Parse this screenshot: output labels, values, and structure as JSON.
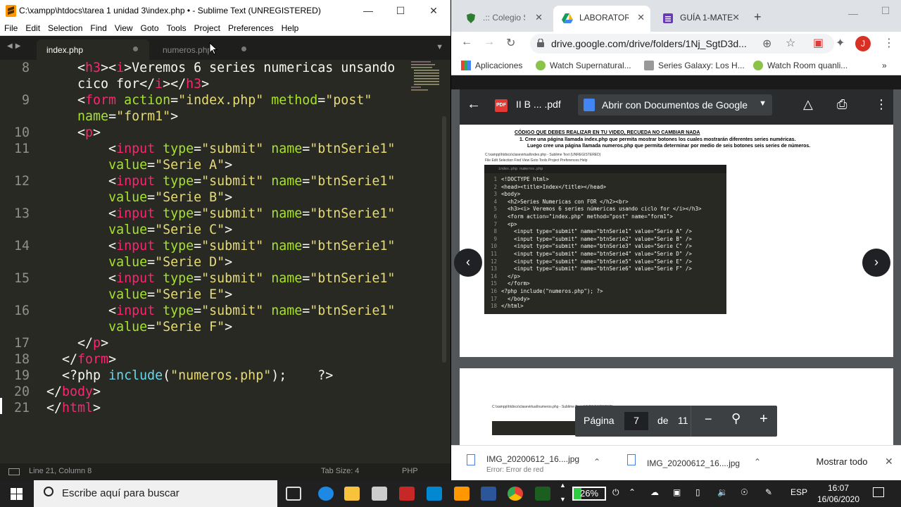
{
  "sublime": {
    "title": "C:\\xampp\\htdocs\\tarea 1 unidad 3\\index.php • - Sublime Text (UNREGISTERED)",
    "menu": [
      "File",
      "Edit",
      "Selection",
      "Find",
      "View",
      "Goto",
      "Tools",
      "Project",
      "Preferences",
      "Help"
    ],
    "tabs": [
      {
        "label": "index.php",
        "active": true
      },
      {
        "label": "numeros.php",
        "active": false
      }
    ],
    "code_lines": [
      {
        "num": "8",
        "segs": [
          [
            "    ",
            "p"
          ],
          [
            "<",
            "p"
          ],
          [
            "h3",
            "tag"
          ],
          [
            "><",
            "p"
          ],
          [
            "i",
            "tag"
          ],
          [
            ">Veremos 6 series numericas unsando",
            "p"
          ]
        ]
      },
      {
        "num": "",
        "segs": [
          [
            "    cico for</",
            "p"
          ],
          [
            "i",
            "tag"
          ],
          [
            "></",
            "p"
          ],
          [
            "h3",
            "tag"
          ],
          [
            ">",
            "p"
          ]
        ]
      },
      {
        "num": "9",
        "segs": [
          [
            "    <",
            "p"
          ],
          [
            "form",
            "tag"
          ],
          [
            " ",
            "p"
          ],
          [
            "action",
            "attr"
          ],
          [
            "=",
            "p"
          ],
          [
            "\"index.php\"",
            "str"
          ],
          [
            " ",
            "p"
          ],
          [
            "method",
            "attr"
          ],
          [
            "=",
            "p"
          ],
          [
            "\"post\"",
            "str"
          ]
        ]
      },
      {
        "num": "",
        "segs": [
          [
            "    ",
            "p"
          ],
          [
            "name",
            "attr"
          ],
          [
            "=",
            "p"
          ],
          [
            "\"form1\"",
            "str"
          ],
          [
            ">",
            "p"
          ]
        ]
      },
      {
        "num": "10",
        "segs": [
          [
            "    <",
            "p"
          ],
          [
            "p",
            "tag"
          ],
          [
            ">",
            "p"
          ]
        ]
      },
      {
        "num": "11",
        "segs": [
          [
            "        <",
            "p"
          ],
          [
            "input",
            "tag"
          ],
          [
            " ",
            "p"
          ],
          [
            "type",
            "attr"
          ],
          [
            "=",
            "p"
          ],
          [
            "\"submit\"",
            "str"
          ],
          [
            " ",
            "p"
          ],
          [
            "name",
            "attr"
          ],
          [
            "=",
            "p"
          ],
          [
            "\"btnSerie1\"",
            "str"
          ]
        ]
      },
      {
        "num": "",
        "segs": [
          [
            "        ",
            "p"
          ],
          [
            "value",
            "attr"
          ],
          [
            "=",
            "p"
          ],
          [
            "\"Serie A\"",
            "str"
          ],
          [
            ">",
            "p"
          ]
        ]
      },
      {
        "num": "12",
        "segs": [
          [
            "        <",
            "p"
          ],
          [
            "input",
            "tag"
          ],
          [
            " ",
            "p"
          ],
          [
            "type",
            "attr"
          ],
          [
            "=",
            "p"
          ],
          [
            "\"submit\"",
            "str"
          ],
          [
            " ",
            "p"
          ],
          [
            "name",
            "attr"
          ],
          [
            "=",
            "p"
          ],
          [
            "\"btnSerie1\"",
            "str"
          ]
        ]
      },
      {
        "num": "",
        "segs": [
          [
            "        ",
            "p"
          ],
          [
            "value",
            "attr"
          ],
          [
            "=",
            "p"
          ],
          [
            "\"Serie B\"",
            "str"
          ],
          [
            ">",
            "p"
          ]
        ]
      },
      {
        "num": "13",
        "segs": [
          [
            "        <",
            "p"
          ],
          [
            "input",
            "tag"
          ],
          [
            " ",
            "p"
          ],
          [
            "type",
            "attr"
          ],
          [
            "=",
            "p"
          ],
          [
            "\"submit\"",
            "str"
          ],
          [
            " ",
            "p"
          ],
          [
            "name",
            "attr"
          ],
          [
            "=",
            "p"
          ],
          [
            "\"btnSerie1\"",
            "str"
          ]
        ]
      },
      {
        "num": "",
        "segs": [
          [
            "        ",
            "p"
          ],
          [
            "value",
            "attr"
          ],
          [
            "=",
            "p"
          ],
          [
            "\"Serie C\"",
            "str"
          ],
          [
            ">",
            "p"
          ]
        ]
      },
      {
        "num": "14",
        "segs": [
          [
            "        <",
            "p"
          ],
          [
            "input",
            "tag"
          ],
          [
            " ",
            "p"
          ],
          [
            "type",
            "attr"
          ],
          [
            "=",
            "p"
          ],
          [
            "\"submit\"",
            "str"
          ],
          [
            " ",
            "p"
          ],
          [
            "name",
            "attr"
          ],
          [
            "=",
            "p"
          ],
          [
            "\"btnSerie1\"",
            "str"
          ]
        ]
      },
      {
        "num": "",
        "segs": [
          [
            "        ",
            "p"
          ],
          [
            "value",
            "attr"
          ],
          [
            "=",
            "p"
          ],
          [
            "\"Serie D\"",
            "str"
          ],
          [
            ">",
            "p"
          ]
        ]
      },
      {
        "num": "15",
        "segs": [
          [
            "        <",
            "p"
          ],
          [
            "input",
            "tag"
          ],
          [
            " ",
            "p"
          ],
          [
            "type",
            "attr"
          ],
          [
            "=",
            "p"
          ],
          [
            "\"submit\"",
            "str"
          ],
          [
            " ",
            "p"
          ],
          [
            "name",
            "attr"
          ],
          [
            "=",
            "p"
          ],
          [
            "\"btnSerie1\"",
            "str"
          ]
        ]
      },
      {
        "num": "",
        "segs": [
          [
            "        ",
            "p"
          ],
          [
            "value",
            "attr"
          ],
          [
            "=",
            "p"
          ],
          [
            "\"Serie E\"",
            "str"
          ],
          [
            ">",
            "p"
          ]
        ]
      },
      {
        "num": "16",
        "segs": [
          [
            "        <",
            "p"
          ],
          [
            "input",
            "tag"
          ],
          [
            " ",
            "p"
          ],
          [
            "type",
            "attr"
          ],
          [
            "=",
            "p"
          ],
          [
            "\"submit\"",
            "str"
          ],
          [
            " ",
            "p"
          ],
          [
            "name",
            "attr"
          ],
          [
            "=",
            "p"
          ],
          [
            "\"btnSerie1\"",
            "str"
          ]
        ]
      },
      {
        "num": "",
        "segs": [
          [
            "        ",
            "p"
          ],
          [
            "value",
            "attr"
          ],
          [
            "=",
            "p"
          ],
          [
            "\"Serie F\"",
            "str"
          ],
          [
            ">",
            "p"
          ]
        ]
      },
      {
        "num": "17",
        "segs": [
          [
            "    </",
            "p"
          ],
          [
            "p",
            "tag"
          ],
          [
            ">",
            "p"
          ]
        ]
      },
      {
        "num": "18",
        "segs": [
          [
            "  </",
            "p"
          ],
          [
            "form",
            "tag"
          ],
          [
            ">",
            "p"
          ]
        ]
      },
      {
        "num": "19",
        "segs": [
          [
            "  <?php ",
            "p"
          ],
          [
            "include",
            "fn"
          ],
          [
            "(",
            "p"
          ],
          [
            "\"numeros.php\"",
            "str"
          ],
          [
            ");    ?>",
            "p"
          ]
        ]
      },
      {
        "num": "20",
        "segs": [
          [
            "</",
            "p"
          ],
          [
            "body",
            "tag"
          ],
          [
            ">",
            "p"
          ]
        ]
      },
      {
        "num": "21",
        "segs": [
          [
            "</",
            "p"
          ],
          [
            "html",
            "tag"
          ],
          [
            ">",
            "p"
          ]
        ]
      }
    ],
    "status": {
      "position": "Line 21, Column 8",
      "tab_size": "Tab Size: 4",
      "syntax": "PHP"
    }
  },
  "chrome": {
    "tabs": [
      {
        "label": ".:: Colegio Sa",
        "icon": "shield-icon",
        "color": "#2e7d32"
      },
      {
        "label": "LABORATORI",
        "icon": "google-drive-icon",
        "color": "#f4b400"
      },
      {
        "label": "GUÍA 1-MATE",
        "icon": "google-forms-icon",
        "color": "#673ab7"
      }
    ],
    "url": "drive.google.com/drive/folders/1Nj_SgtD3d...",
    "bookmarks": [
      "Aplicaciones",
      "Watch Supernatural...",
      "Series Galaxy: Los H...",
      "Watch Room quanli..."
    ],
    "viewer": {
      "filename": "II B ... .pdf",
      "open_with": "Abrir con Documentos de Google",
      "page_heading": "CÓDIGO QUE DEBES REALIZAR EN TU VIDEO, RECUEDA NO CAMBIAR NADA",
      "page_line1": "1.  Cree una página llamada index.php que permita mostrar botones los cuales mostrarán diferentes series numéricas.",
      "page_line2": "Luego cree una página llamada numeros.php que permita determinar por medio de seis botones seis series de números.",
      "embedded_title": "C:\\xampp\\htdocs\\clasevirtual\\index.php - Sublime Text (UNREGISTERED)",
      "embedded_menu": "File   Edit   Selection   Find   View   Goto   Tools   Project   Preferences   Help",
      "embedded_tabs": "index.php                  numeros.php",
      "embedded_code": [
        [
          "1",
          "<!DOCTYPE html>"
        ],
        [
          "2",
          "<head><title>Index</title></head>"
        ],
        [
          "3",
          "<body>"
        ],
        [
          "4",
          "  <h2>Series Numericas con FOR </h2><br>"
        ],
        [
          "5",
          "  <h3><i> Veremos 6 series númericas usando ciclo for </i></h3>"
        ],
        [
          "6",
          "  <form action=\"index.php\" method=\"post\" name=\"form1\">"
        ],
        [
          "7",
          "  <p>"
        ],
        [
          "8",
          "    <input type=\"submit\" name=\"btnSerie1\" value=\"Serie A\" />"
        ],
        [
          "9",
          "    <input type=\"submit\" name=\"btnSerie2\" value=\"Serie B\" />"
        ],
        [
          "10",
          "    <input type=\"submit\" name=\"btnSerie3\" value=\"Serie C\" />"
        ],
        [
          "11",
          "    <input type=\"submit\" name=\"btnSerie4\" value=\"Serie D\" />"
        ],
        [
          "12",
          "    <input type=\"submit\" name=\"btnSerie5\" value=\"Serie E\" />"
        ],
        [
          "13",
          "    <input type=\"submit\" name=\"btnSerie6\" value=\"Serie F\" />"
        ],
        [
          "14",
          "  </p>"
        ],
        [
          "15",
          "  </form>"
        ],
        [
          "16",
          "<?php include(\"numeros.php\"); ?>"
        ],
        [
          "17",
          "  </body>"
        ],
        [
          "18",
          "</html>"
        ]
      ],
      "page2_hint": "C:\\xampp\\htdocs\\clasevirtual\\numeros.php - Sublime Text (UNREGISTERED)",
      "page_label": "Página",
      "page_current": "7",
      "page_of": "de",
      "page_total": "11"
    },
    "downloads": [
      {
        "name": "IMG_20200612_16....jpg",
        "sub": "Error: Error de red"
      },
      {
        "name": "IMG_20200612_16....jpg",
        "sub": ""
      }
    ],
    "show_all": "Mostrar todo"
  },
  "taskbar": {
    "search_placeholder": "Escribe aquí para buscar",
    "battery_percent": "26%",
    "battery_level": 0.26,
    "language": "ESP",
    "time": "16:07",
    "date": "16/06/2020"
  }
}
